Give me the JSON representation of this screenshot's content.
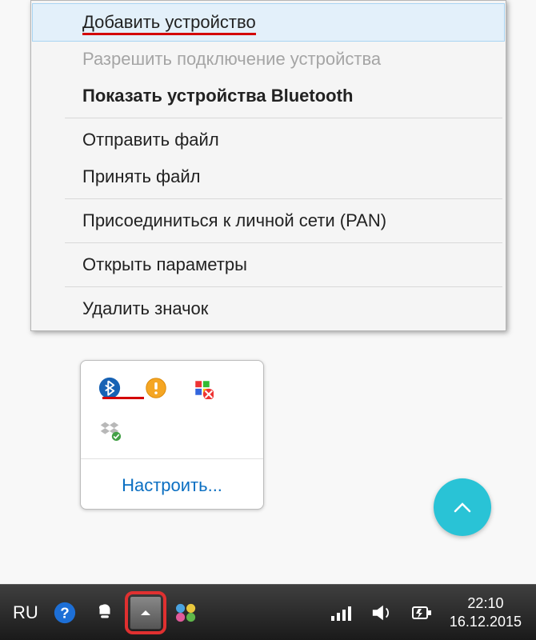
{
  "menu": {
    "add_device": "Добавить устройство",
    "allow_connect": "Разрешить подключение устройства",
    "show_bt": "Показать устройства Bluetooth",
    "send_file": "Отправить файл",
    "receive_file": "Принять файл",
    "join_pan": "Присоединиться к личной сети (PAN)",
    "open_settings": "Открыть параметры",
    "remove_icon": "Удалить значок"
  },
  "tray": {
    "customize": "Настроить...",
    "icons": {
      "bluetooth": "bluetooth-icon",
      "sound": "sound-warning-icon",
      "security": "security-alert-icon",
      "dropbox": "dropbox-icon"
    }
  },
  "taskbar": {
    "lang": "RU",
    "time": "22:10",
    "date": "16.12.2015"
  }
}
